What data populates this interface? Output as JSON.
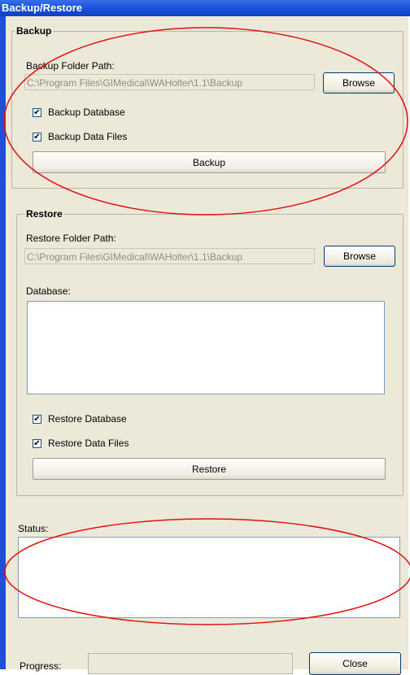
{
  "window": {
    "title": "Backup/Restore"
  },
  "backup": {
    "title": "Backup",
    "folder_label": "Backup Folder Path:",
    "folder_value": "C:\\Program Files\\GIMedical\\WAHolter\\1.1\\Backup",
    "browse_label": "Browse",
    "check_database_label": "Backup Database",
    "check_files_label": "Backup Data Files",
    "action_label": "Backup"
  },
  "restore": {
    "title": "Restore",
    "folder_label": "Restore Folder Path:",
    "folder_value": "C:\\Program Files\\GIMedical\\WAHolter\\1.1\\Backup",
    "browse_label": "Browse",
    "database_label": "Database:",
    "check_database_label": "Restore Database",
    "check_files_label": "Restore Data Files",
    "action_label": "Restore"
  },
  "status": {
    "label": "Status:"
  },
  "footer": {
    "progress_label": "Progress:",
    "close_label": "Close"
  },
  "annotations": {
    "color": "#e01010"
  },
  "checkbox_mark": "✔"
}
